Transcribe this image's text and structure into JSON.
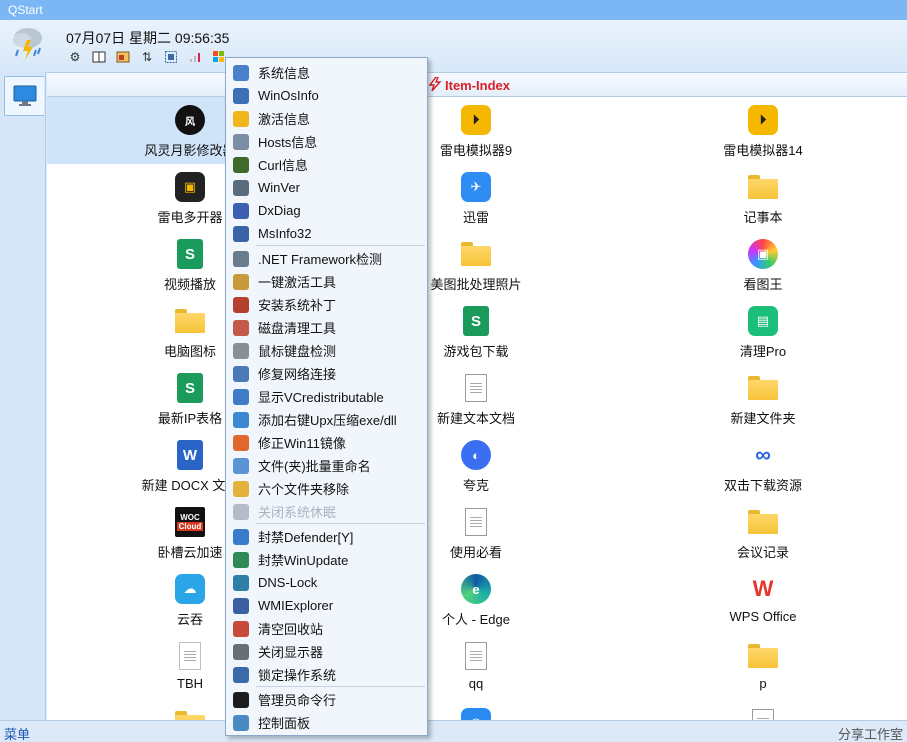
{
  "window": {
    "title": "QStart"
  },
  "header": {
    "datetime": "07月07日 星期二 09:56:35",
    "tool_icons": [
      "gear-icon",
      "book-icon",
      "image-icon",
      "sort-icon",
      "screen-capture-icon",
      "signal-icon",
      "windows-logo-icon"
    ]
  },
  "content": {
    "title": "Item-Index"
  },
  "grid": [
    {
      "label": "风灵月影修改器",
      "icon": "fengling-icon"
    },
    {
      "label": "雷电模拟器9",
      "icon": "ldplayer-icon"
    },
    {
      "label": "雷电模拟器14",
      "icon": "ldplayer-icon"
    },
    {
      "label": "雷电多开器",
      "icon": "ldmulti-icon"
    },
    {
      "label": "迅雷",
      "icon": "xunlei-icon"
    },
    {
      "label": "记事本",
      "icon": "folder-icon"
    },
    {
      "label": "视频播放",
      "icon": "sheet-icon"
    },
    {
      "label": "美图批处理照片",
      "icon": "folder-icon"
    },
    {
      "label": "看图王",
      "icon": "kantu-icon"
    },
    {
      "label": "电脑图标",
      "icon": "folder-icon"
    },
    {
      "label": "游戏包下载",
      "icon": "sheet-icon"
    },
    {
      "label": "清理Pro",
      "icon": "cleanpro-icon"
    },
    {
      "label": "最新IP表格",
      "icon": "sheet-icon"
    },
    {
      "label": "新建文本文档",
      "icon": "text-file-icon"
    },
    {
      "label": "新建文件夹",
      "icon": "folder-icon"
    },
    {
      "label": "新建 DOCX 文档",
      "icon": "word-icon"
    },
    {
      "label": "夸克",
      "icon": "quark-icon"
    },
    {
      "label": "双击下载资源",
      "icon": "baidu-icon"
    },
    {
      "label": "卧槽云加速",
      "icon": "woc-cloud-icon"
    },
    {
      "label": "使用必看",
      "icon": "text-file-icon"
    },
    {
      "label": "会议记录",
      "icon": "folder-icon"
    },
    {
      "label": "云吞",
      "icon": "yuntun-icon"
    },
    {
      "label": "个人 - Edge",
      "icon": "edge-icon"
    },
    {
      "label": "WPS Office",
      "icon": "wps-icon"
    },
    {
      "label": "TBH",
      "icon": "blank-file-icon"
    },
    {
      "label": "qq",
      "icon": "text-file-icon"
    },
    {
      "label": "p",
      "icon": "folder-icon"
    },
    {
      "label": "",
      "icon": "folder-icon"
    },
    {
      "label": "",
      "icon": "qq-icon"
    },
    {
      "label": "",
      "icon": "text-file-icon"
    }
  ],
  "context_menu": {
    "groups": [
      [
        {
          "label": "系统信息",
          "icon": "system-info-icon",
          "color": "#4a7fc9"
        },
        {
          "label": "WinOsInfo",
          "icon": "computer-icon",
          "color": "#3b6fb6"
        },
        {
          "label": "激活信息",
          "icon": "star-icon",
          "color": "#f2b51c"
        },
        {
          "label": "Hosts信息",
          "icon": "hosts-icon",
          "color": "#7b8ea3"
        },
        {
          "label": "Curl信息",
          "icon": "terminal-icon",
          "color": "#3f6a2c"
        },
        {
          "label": "WinVer",
          "icon": "winver-icon",
          "color": "#5a6b7c"
        },
        {
          "label": "DxDiag",
          "icon": "dxdiag-icon",
          "color": "#3d5fb0"
        },
        {
          "label": "MsInfo32",
          "icon": "msinfo-icon",
          "color": "#3a64a8"
        }
      ],
      [
        {
          "label": ".NET Framework检测",
          "icon": "dotnet-icon",
          "color": "#6a7b8c"
        },
        {
          "label": "一键激活工具",
          "icon": "key-icon",
          "color": "#c89a3a"
        },
        {
          "label": "安装系统补丁",
          "icon": "package-icon",
          "color": "#b5412d"
        },
        {
          "label": "磁盘清理工具",
          "icon": "disk-cleanup-icon",
          "color": "#c65a4a"
        },
        {
          "label": "鼠标键盘检测",
          "icon": "mouse-icon",
          "color": "#8a8f96"
        },
        {
          "label": "修复网络连接",
          "icon": "network-icon",
          "color": "#4a79b8"
        },
        {
          "label": "显示VCredistributable",
          "icon": "vc-redist-icon",
          "color": "#3f7cc7"
        },
        {
          "label": "添加右键Upx压缩exe/dll",
          "icon": "upx-icon",
          "color": "#3b88d0"
        },
        {
          "label": "修正Win11镜像",
          "icon": "fire-icon",
          "color": "#e0682c"
        },
        {
          "label": "文件(夹)批量重命名",
          "icon": "rename-icon",
          "color": "#5a93d6"
        },
        {
          "label": "六个文件夹移除",
          "icon": "folder-remove-icon",
          "color": "#e2b23a"
        },
        {
          "label": "关闭系统休眠",
          "icon": "sleep-icon",
          "color": "#b3bcc7",
          "disabled": true
        }
      ],
      [
        {
          "label": "封禁Defender[Y]",
          "icon": "shield-icon",
          "color": "#3a7ccc"
        },
        {
          "label": "封禁WinUpdate",
          "icon": "globe-icon",
          "color": "#2e8b57"
        },
        {
          "label": "DNS-Lock",
          "icon": "dns-icon",
          "color": "#2e7fa8"
        },
        {
          "label": "WMIExplorer",
          "icon": "wmi-icon",
          "color": "#3a5fa3"
        },
        {
          "label": "清空回收站",
          "icon": "recycle-icon",
          "color": "#c84a3a"
        },
        {
          "label": "关闭显示器",
          "icon": "monitor-off-icon",
          "color": "#6a6f75"
        },
        {
          "label": "锁定操作系统",
          "icon": "lock-icon",
          "color": "#3a6aa8"
        }
      ],
      [
        {
          "label": "管理员命令行",
          "icon": "cmd-icon",
          "color": "#1c1c1c"
        },
        {
          "label": "控制面板",
          "icon": "control-panel-icon",
          "color": "#4a8ac2"
        }
      ]
    ]
  },
  "statusbar": {
    "menu_label": "菜单",
    "share_label": "分享工作室"
  }
}
